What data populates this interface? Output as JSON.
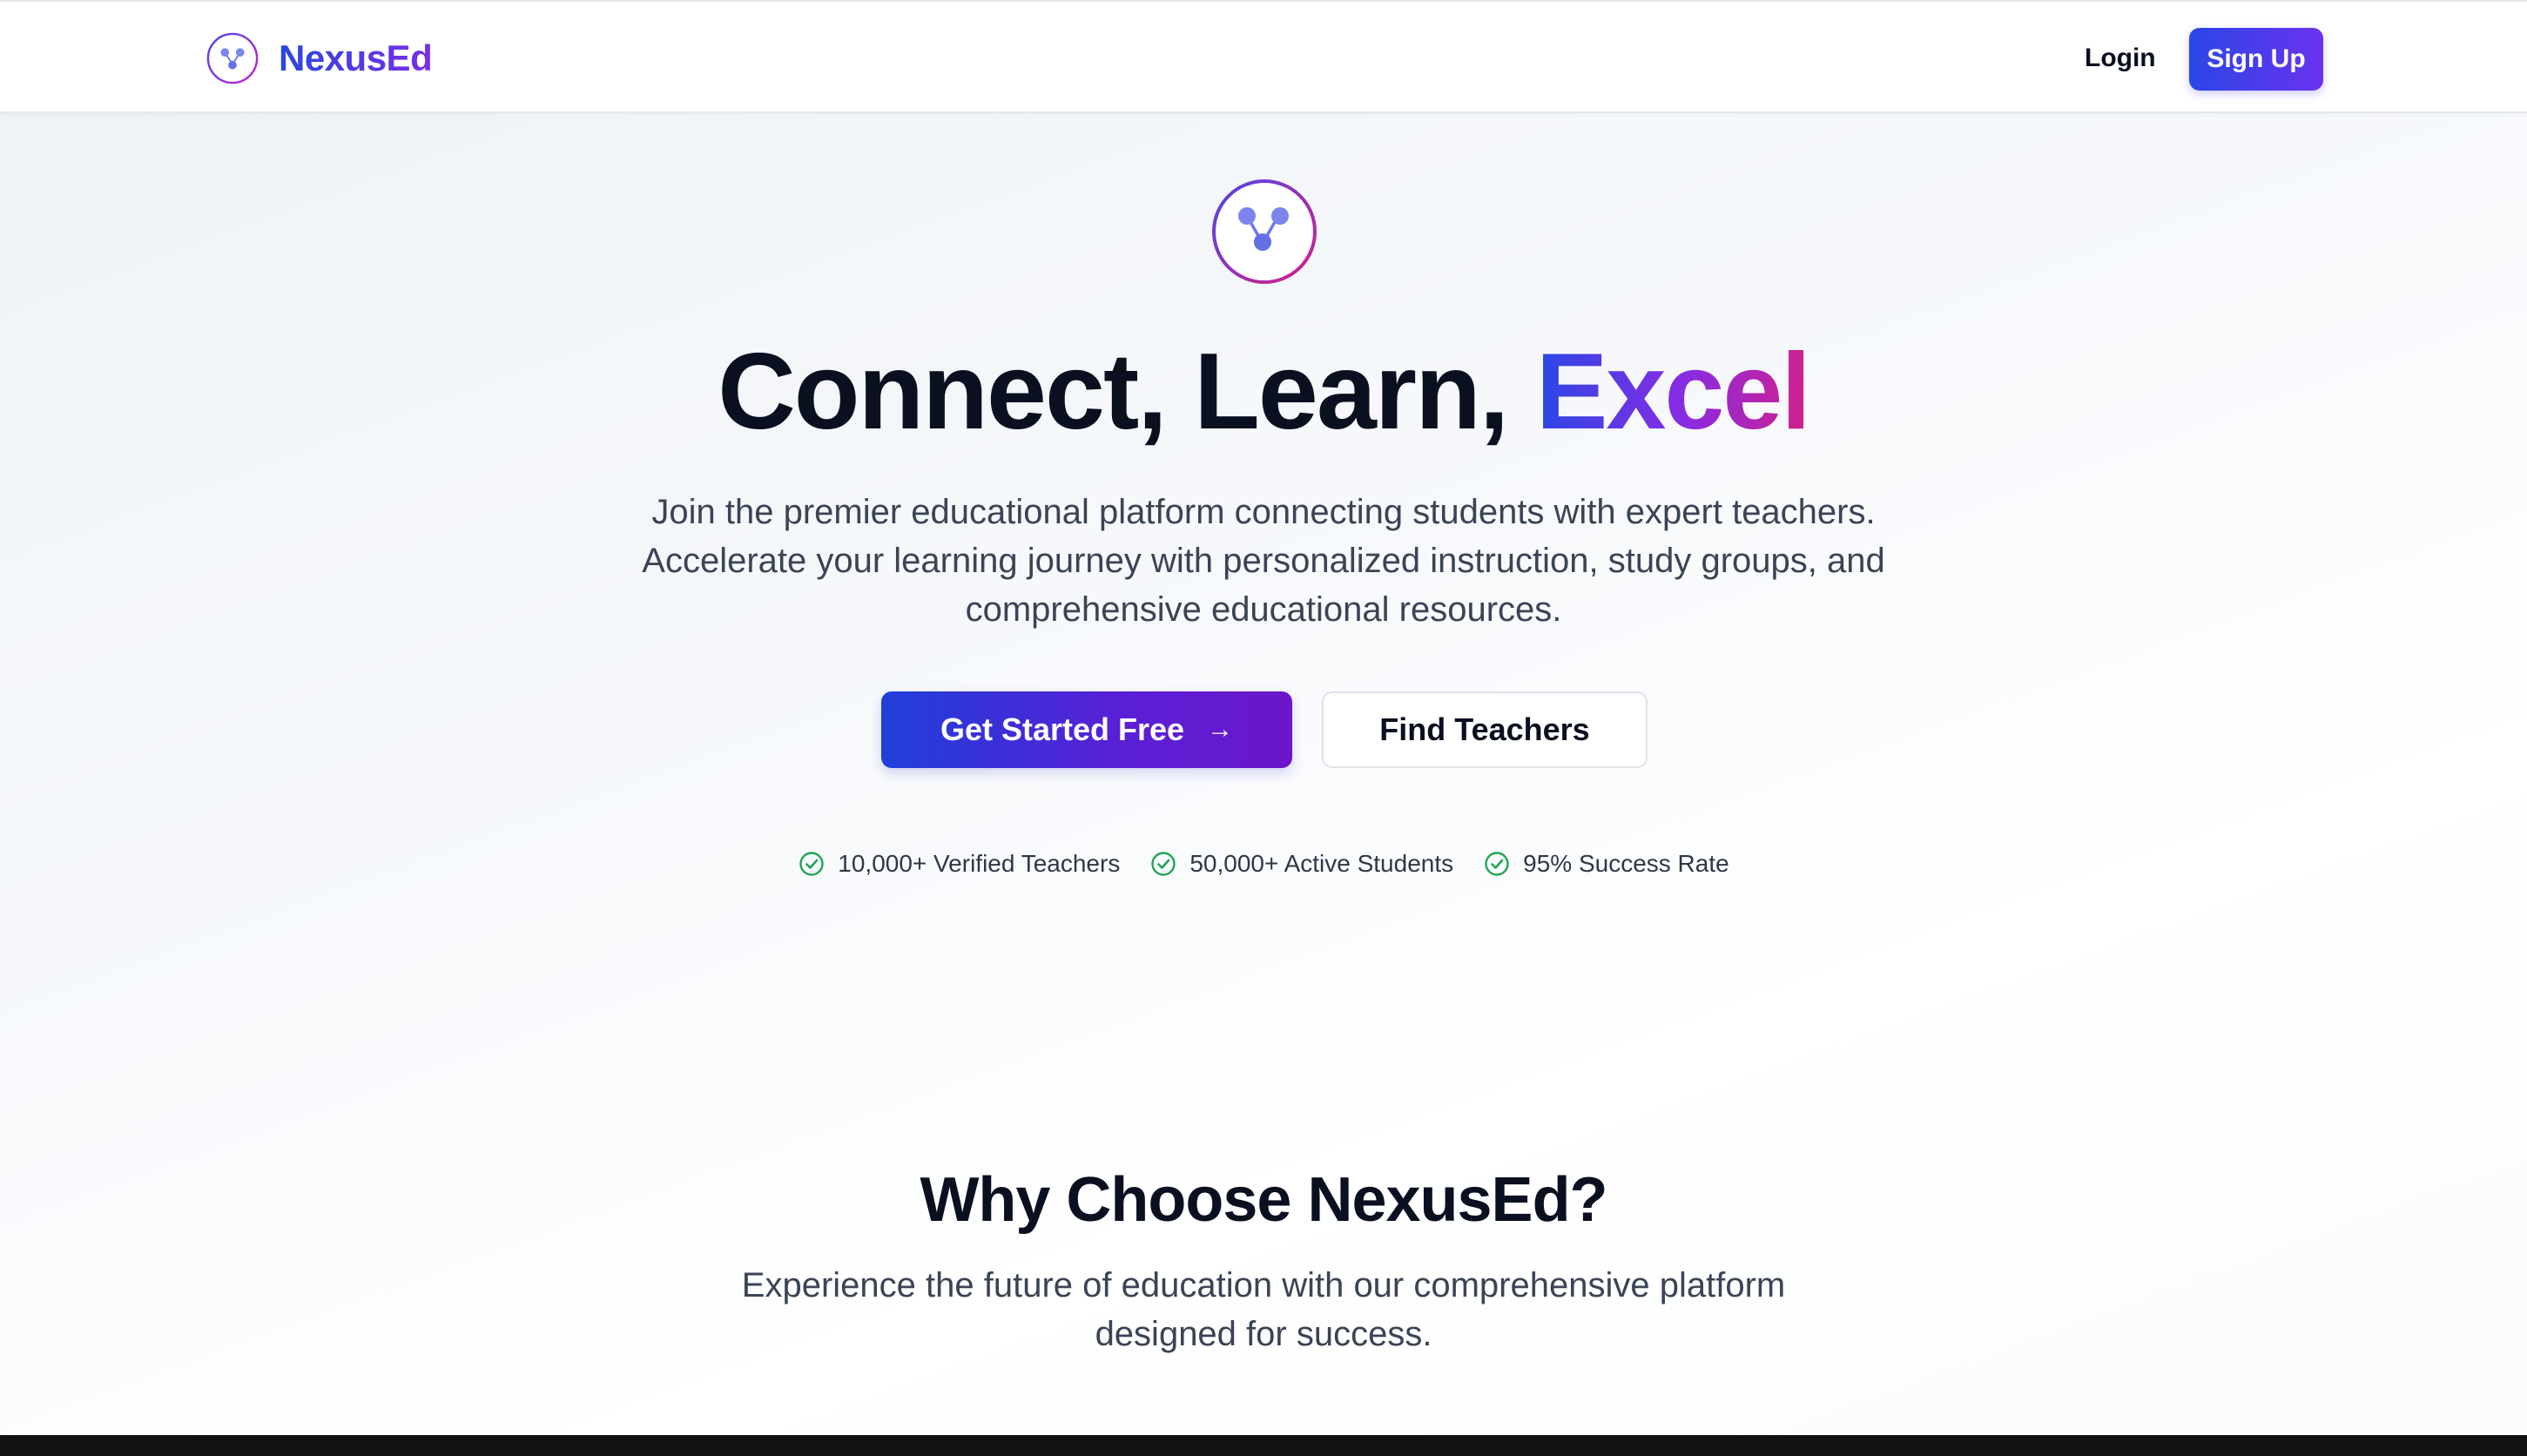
{
  "header": {
    "brand": "NexusEd",
    "login_label": "Login",
    "signup_label": "Sign Up"
  },
  "hero": {
    "title_main": "Connect, Learn, ",
    "title_accent": "Excel",
    "subtitle_lines": [
      "Join the premier educational platform connecting students with expert teachers.",
      "Accelerate your learning journey with personalized instruction, study groups, and",
      "comprehensive educational resources."
    ],
    "primary_button": "Get Started Free",
    "secondary_button": "Find Teachers",
    "stats": [
      "10,000+ Verified Teachers",
      "50,000+ Active Students",
      "95% Success Rate"
    ]
  },
  "why": {
    "title": "Why Choose NexusEd?",
    "subtitle_lines": [
      "Experience the future of education with our comprehensive platform",
      "designed for success."
    ]
  },
  "icons": {
    "logo": "network-nodes-icon",
    "button_arrow": "arrow-right-icon",
    "stat_check": "check-circle-icon"
  },
  "colors": {
    "brand_blue": "#2a47e6",
    "brand_purple": "#7a2de6",
    "accent_pink": "#d1208a",
    "success_green": "#22a455"
  }
}
